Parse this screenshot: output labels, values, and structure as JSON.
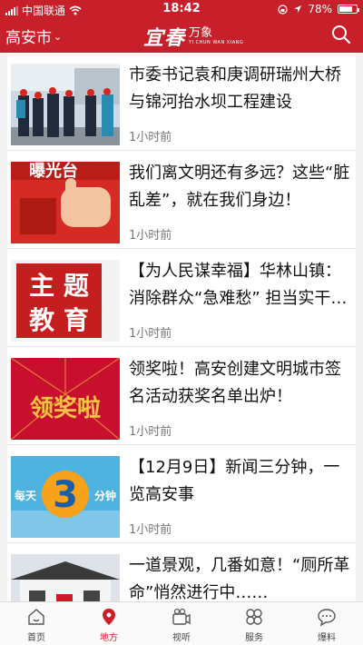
{
  "status_bar": {
    "carrier": "中国联通",
    "time": "18:42",
    "battery_percent": "78%",
    "battery_level": 0.78
  },
  "header": {
    "city": "高安市",
    "logo_main": "宜春",
    "logo_sub": "万象",
    "logo_en": "YI CHUN WAN XIANG"
  },
  "news": [
    {
      "title": "市委书记袁和庚调研瑞州大桥与锦河抬水坝工程建设",
      "time": "1小时前"
    },
    {
      "title": "我们离文明还有多远？这些“脏乱差”，就在我们身边！",
      "time": "1小时前",
      "thumb_text": "曝光台"
    },
    {
      "title": "【为人民谋幸福】华林山镇：消除群众“急难愁” 担当实干…",
      "time": "1小时前",
      "thumb_lines": [
        "主 题",
        "教 育"
      ]
    },
    {
      "title": "领奖啦！高安创建文明城市签名活动获奖名单出炉！",
      "time": "1小时前",
      "thumb_text": "领奖啦"
    },
    {
      "title": "【12月9日】新闻三分钟，一览高安事",
      "time": "1小时前",
      "thumb_left": "每天",
      "thumb_num": "3",
      "thumb_right": "分钟"
    },
    {
      "title": "一道景观，几番如意！“厕所革命”悄然进行中……",
      "time": ""
    }
  ],
  "tabbar": {
    "tabs": [
      {
        "label": "首页",
        "icon": "home-icon"
      },
      {
        "label": "地方",
        "icon": "location-icon"
      },
      {
        "label": "视听",
        "icon": "video-icon"
      },
      {
        "label": "服务",
        "icon": "services-icon"
      },
      {
        "label": "爆料",
        "icon": "chat-icon"
      }
    ],
    "active": "地方"
  },
  "colors": {
    "brand": "#c8202a",
    "active_tab": "#c8202a"
  }
}
